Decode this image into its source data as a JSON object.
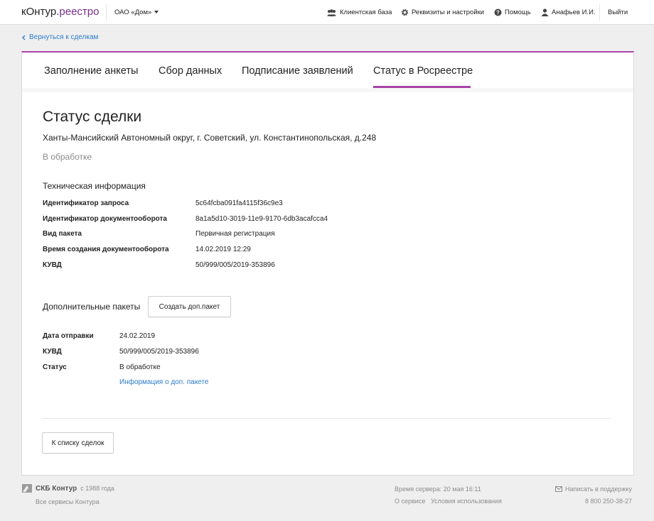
{
  "header": {
    "logo_part1": "кОнтур.",
    "logo_part2": "реестро",
    "org": "ОАО «Дом»",
    "nav": {
      "clients": "Клиентская база",
      "settings": "Реквизиты и настройки",
      "help": "Помощь",
      "user": "Анафьев И.И.",
      "logout": "Выйти"
    }
  },
  "back_link": "Вернуться к сделкам",
  "tabs": [
    {
      "label": "Заполнение анкеты"
    },
    {
      "label": "Сбор данных"
    },
    {
      "label": "Подписание заявлений"
    },
    {
      "label": "Статус в Росреестре"
    }
  ],
  "main": {
    "title": "Статус сделки",
    "address": "Ханты-Мансийский Автономный округ, г. Советский, ул. Константинопольская, д.248",
    "status": "В обработке",
    "tech_title": "Техническая информация",
    "tech": [
      {
        "label": "Идентификатор запроса",
        "value": "5c64fcba091fa4115f36c9e3"
      },
      {
        "label": "Идентификатор документооборота",
        "value": "8a1a5d10-3019-11e9-9170-6db3acafcca4"
      },
      {
        "label": "Вид пакета",
        "value": "Первичная регистрация"
      },
      {
        "label": "Время создания документооборота",
        "value": "14.02.2019 12:29"
      },
      {
        "label": "КУВД",
        "value": "50/999/005/2019-353896"
      }
    ],
    "extra_title": "Дополнительные пакеты",
    "create_button": "Создать доп.пакет",
    "extra": [
      {
        "label": "Дата отправки",
        "value": "24.02.2019"
      },
      {
        "label": "КУВД",
        "value": "50/999/005/2019-353896"
      },
      {
        "label": "Статус",
        "value": "В обработке"
      }
    ],
    "extra_link": "Информация о доп. пакете",
    "back_button": "К списку сделок"
  },
  "footer": {
    "brand": "СКБ Контур",
    "since": "с 1988 года",
    "all_services": "Все сервисы Контура",
    "server_time": "Время сервера: 20 мая 16:11",
    "about": "О сервисе",
    "terms": "Условия использования",
    "support": "Написать в поддержку",
    "phone": "8 800 250-38-27"
  },
  "colors": {
    "accent": "#a844a7",
    "link": "#2d7bc9",
    "muted": "#8c8c8c"
  }
}
